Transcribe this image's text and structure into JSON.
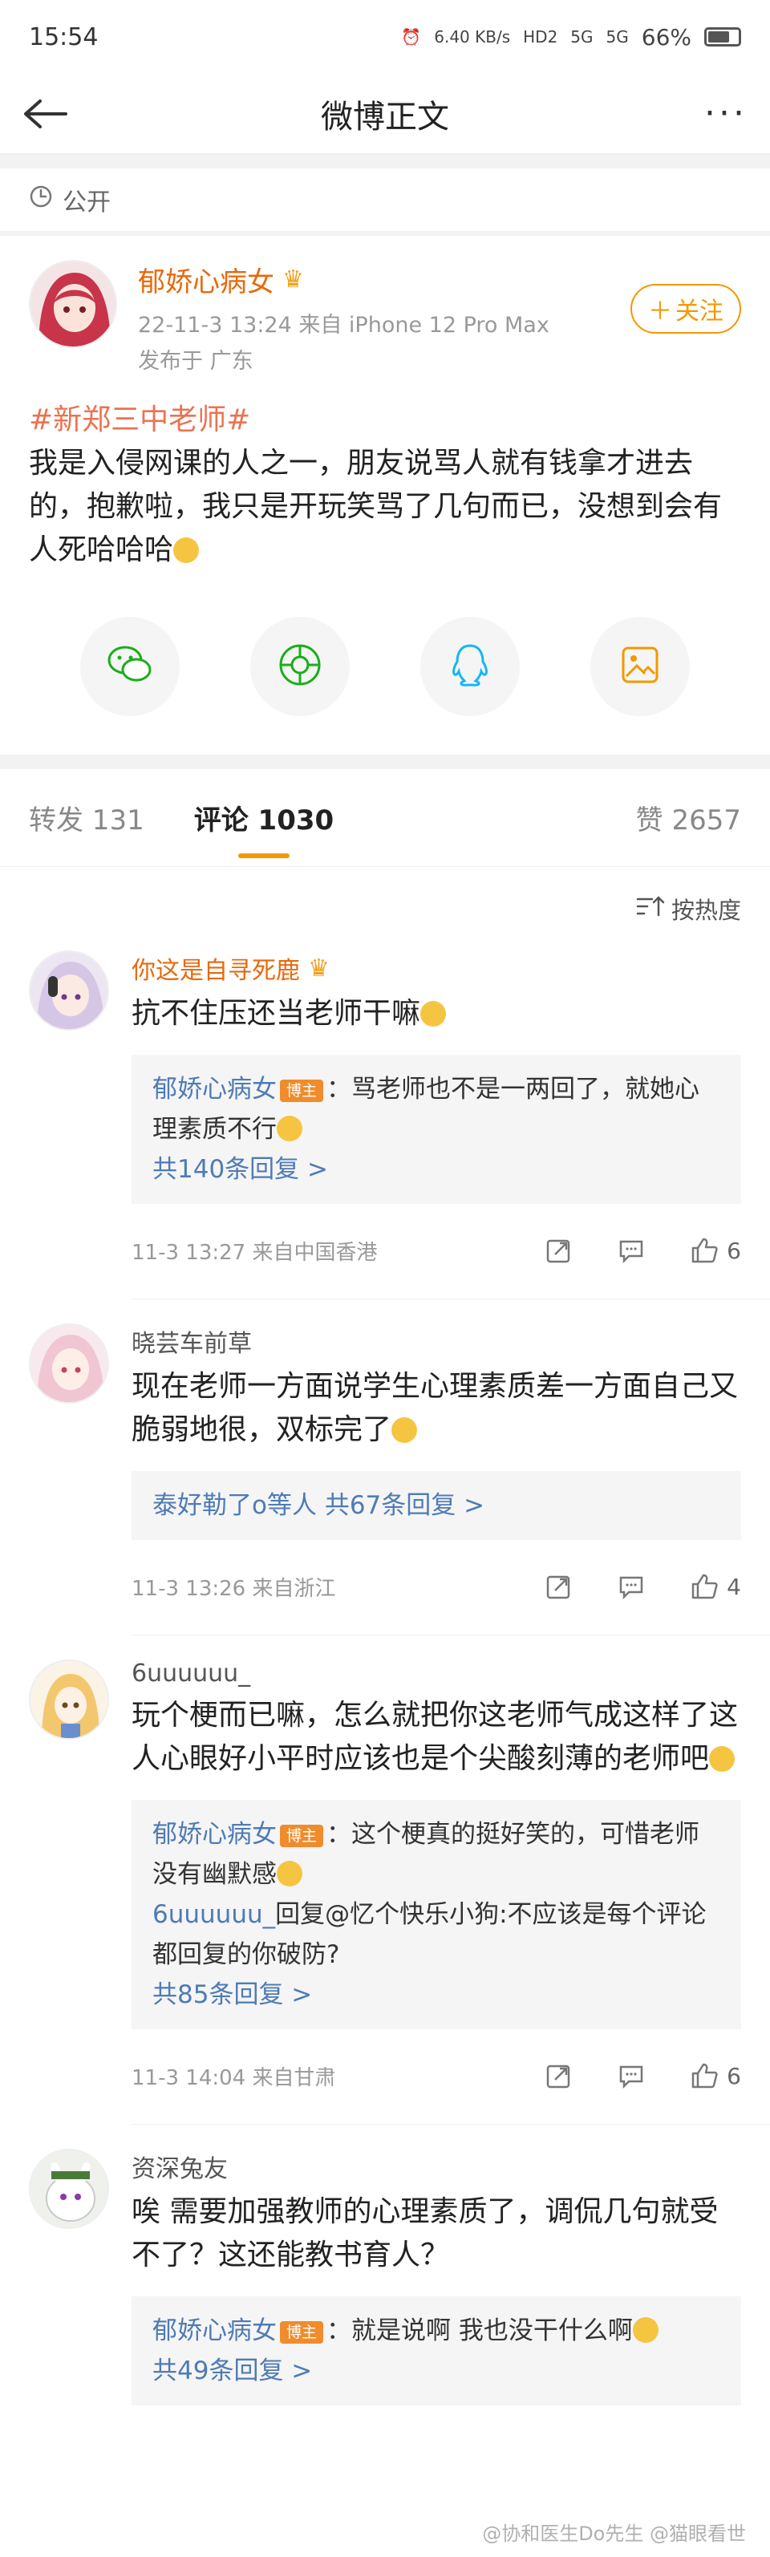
{
  "status_bar": {
    "time": "15:54",
    "speed": "6.40 KB/s",
    "hd": "HD2",
    "signal1": "5G",
    "signal2": "5G",
    "battery": "66%"
  },
  "nav": {
    "title": "微博正文"
  },
  "visibility": {
    "label": "公开"
  },
  "post": {
    "author": "郁娇心病女",
    "follow_label": "关注",
    "datetime_source": "22-11-3 13:24  来自 iPhone 12 Pro Max",
    "location": "发布于 广东",
    "hashtag": "#新郑三中老师#",
    "body": "我是入侵网课的人之一，朋友说骂人就有钱拿才进去的，抱歉啦，我只是开玩笑骂了几句而已，没想到会有人死哈哈哈"
  },
  "share_icons": [
    "wechat-icon",
    "moments-icon",
    "qq-icon",
    "save-image-icon"
  ],
  "tabs": {
    "repost": "转发 131",
    "comments": "评论 1030",
    "likes": "赞 2657"
  },
  "sort_label": "按热度",
  "comments": [
    {
      "name": "你这是自寻死鹿",
      "name_orange": true,
      "text": "抗不住压还当老师干嘛",
      "reply_author": "郁娇心病女",
      "reply_badge": "博主",
      "reply_text": "：骂老师也不是一两回了，就她心理素质不行",
      "reply2_author": "",
      "reply2_text": "",
      "more": "共140条回复 >",
      "time": "11-3 13:27  来自中国香港",
      "likes": "6"
    },
    {
      "name": "晓芸车前草",
      "name_orange": false,
      "text": "现在老师一方面说学生心理素质差一方面自己又脆弱地很，双标完了",
      "more": "泰好勒了o等人  共67条回复 >",
      "time": "11-3 13:26  来自浙江",
      "likes": "4"
    },
    {
      "name": "6uuuuuu_",
      "name_orange": false,
      "text": "玩个梗而已嘛，怎么就把你这老师气成这样了这人心眼好小平时应该也是个尖酸刻薄的老师吧",
      "reply_author": "郁娇心病女",
      "reply_badge": "博主",
      "reply_text": "：这个梗真的挺好笑的，可惜老师没有幽默感",
      "reply2_author": "6uuuuuu_",
      "reply2_text": "回复@忆个快乐小狗:不应该是每个评论都回复的你破防?",
      "more": "共85条回复 >",
      "time": "11-3 14:04  来自甘肃",
      "likes": "6"
    },
    {
      "name": "资深兔友",
      "name_orange": false,
      "text": "唉 需要加强教师的心理素质了，调侃几句就受不了？这还能教书育人？",
      "reply_author": "郁娇心病女",
      "reply_badge": "博主",
      "reply_text": "：就是说啊 我也没干什么啊",
      "more": "共49条回复 >"
    }
  ],
  "watermark": "@协和医生Do先生  @猫眼看世"
}
